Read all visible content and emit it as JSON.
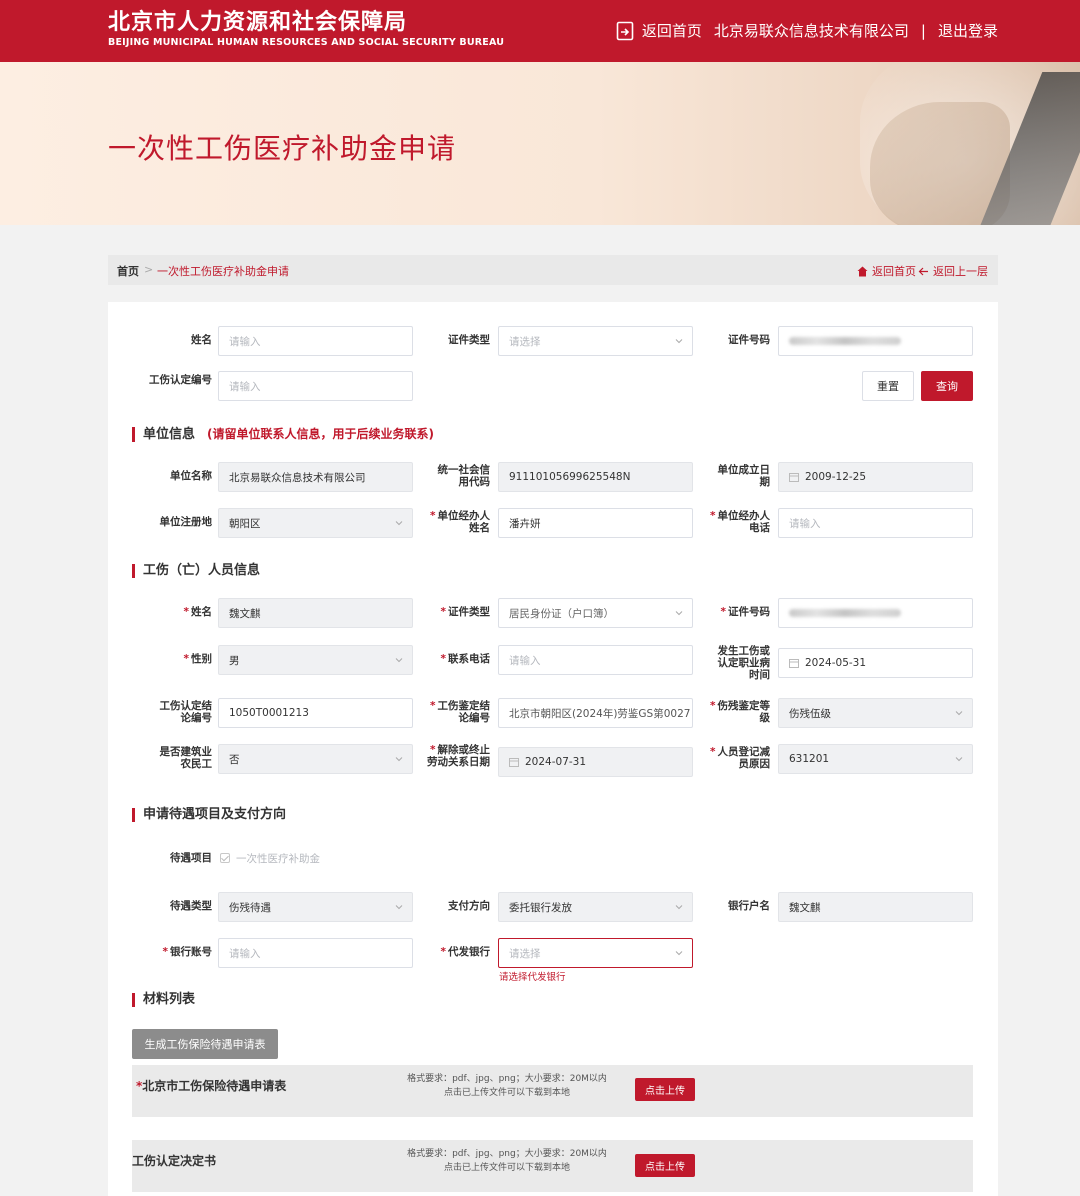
{
  "header": {
    "title_cn": "北京市人力资源和社会保障局",
    "title_en": "BEIJING MUNICIPAL HUMAN RESOURCES AND SOCIAL SECURITY BUREAU",
    "home_link": "返回首页",
    "company": "北京易联众信息技术有限公司",
    "separator": "|",
    "logout": "退出登录"
  },
  "banner": {
    "title": "一次性工伤医疗补助金申请"
  },
  "breadcrumb": {
    "home": "首页",
    "separator": ">",
    "current": "一次性工伤医疗补助金申请",
    "back_home": "返回首页",
    "back_prev": "返回上一层"
  },
  "search": {
    "name_label": "姓名",
    "name_placeholder": "请输入",
    "idtype_label": "证件类型",
    "idtype_placeholder": "请选择",
    "idno_label": "证件号码",
    "injury_no_label": "工伤认定编号",
    "injury_no_placeholder": "请输入",
    "reset_label": "重置",
    "query_label": "查询"
  },
  "unit": {
    "section_title": "单位信息",
    "section_note": "(请留单位联系人信息，用于后续业务联系)",
    "name_label": "单位名称",
    "name_value": "北京易联众信息技术有限公司",
    "credit_label": "统一社会信用代码",
    "credit_value": "91110105699625548N",
    "founded_label": "单位成立日期",
    "founded_value": "2009-12-25",
    "district_label": "单位注册地",
    "district_value": "朝阳区",
    "agent_label": "单位经办人姓名",
    "agent_value": "潘卉妍",
    "agent_phone_label": "单位经办人电话",
    "agent_phone_placeholder": "请输入"
  },
  "person": {
    "section_title": "工伤（亡）人员信息",
    "name_label": "姓名",
    "name_value": "魏文麒",
    "idtype_label": "证件类型",
    "idtype_value": "居民身份证（户口簿）",
    "idno_label": "证件号码",
    "gender_label": "性别",
    "gender_value": "男",
    "phone_label": "联系电话",
    "phone_placeholder": "请输入",
    "injury_date_label": "发生工伤或认定职业病时间",
    "injury_date_value": "2024-05-31",
    "conclusion_no_label": "工伤认定结论编号",
    "conclusion_no_value": "1050T0001213",
    "appraisal_no_label": "工伤鉴定结论编号",
    "appraisal_no_value": "北京市朝阳区(2024年)劳鉴GS第0027",
    "disability_label": "伤残鉴定等级",
    "disability_value": "伤残伍级",
    "construction_label": "是否建筑业农民工",
    "construction_value": "否",
    "termination_label": "解除或终止劳动关系日期",
    "termination_value": "2024-07-31",
    "reduce_reason_label": "人员登记减员原因",
    "reduce_reason_value": "631201"
  },
  "payment": {
    "section_title": "申请待遇项目及支付方向",
    "item_label": "待遇项目",
    "item_value": "一次性医疗补助金",
    "type_label": "待遇类型",
    "type_value": "伤残待遇",
    "direction_label": "支付方向",
    "direction_value": "委托银行发放",
    "account_name_label": "银行户名",
    "account_name_value": "魏文麒",
    "account_no_label": "银行账号",
    "account_no_placeholder": "请输入",
    "bank_label": "代发银行",
    "bank_placeholder": "请选择",
    "bank_error": "请选择代发银行"
  },
  "materials": {
    "section_title": "材料列表",
    "generate_label": "生成工伤保险待遇申请表",
    "items": [
      {
        "title": "北京市工伤保险待遇申请表",
        "required_mark": "*",
        "format": "格式要求：pdf、jpg、png；大小要求：20M以内",
        "hint": "点击已上传文件可以下载到本地",
        "upload_label": "点击上传"
      },
      {
        "title": "工伤认定决定书",
        "required_mark": "",
        "format": "格式要求：pdf、jpg、png；大小要求：20M以内",
        "hint": "点击已上传文件可以下载到本地",
        "upload_label": "点击上传"
      }
    ]
  },
  "required_mark": "*",
  "colors": {
    "brand_red": "#c0192c",
    "disabled_bg": "#f0f1f3",
    "page_bg": "#f2f2f2"
  }
}
